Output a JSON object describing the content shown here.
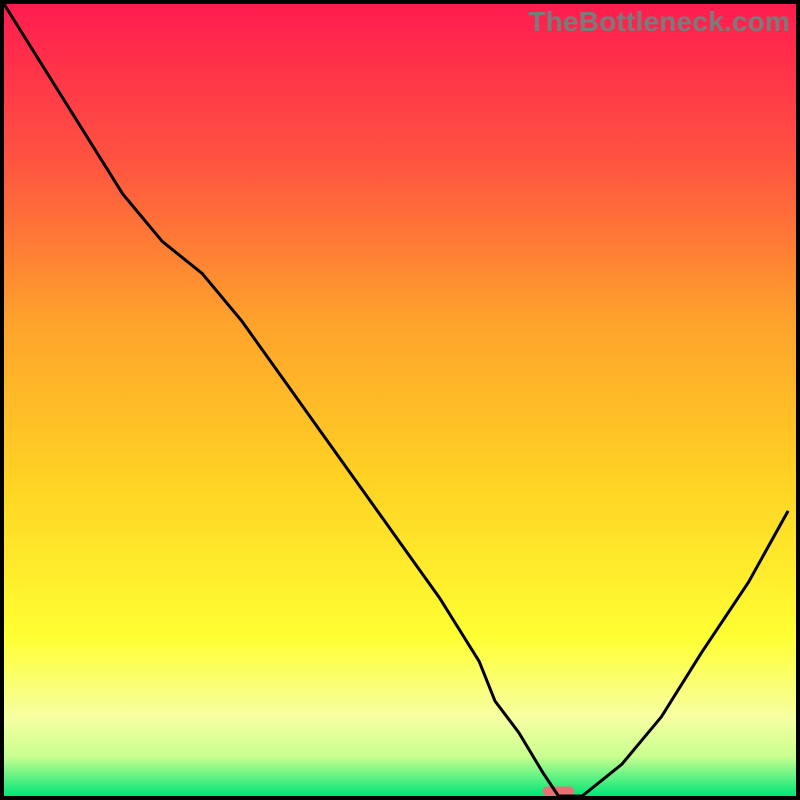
{
  "watermark": "TheBottleneck.com",
  "chart_data": {
    "type": "line",
    "title": "",
    "xlabel": "",
    "ylabel": "",
    "xlim": [
      0,
      100
    ],
    "ylim": [
      0,
      100
    ],
    "grid": false,
    "series": [
      {
        "name": "bottleneck-curve",
        "color": "#000000",
        "x": [
          0,
          5,
          10,
          15,
          20,
          25,
          30,
          35,
          40,
          45,
          50,
          55,
          60,
          62,
          65,
          68,
          70,
          73,
          78,
          83,
          88,
          94,
          99
        ],
        "y": [
          100,
          92,
          84,
          76,
          70,
          66,
          60,
          53,
          46,
          39,
          32,
          25,
          17,
          12,
          8,
          3,
          0,
          0,
          4,
          10,
          18,
          27,
          36
        ]
      }
    ],
    "background_gradient": {
      "type": "vertical",
      "stops": [
        {
          "pct": 0,
          "color": "#ff1c4f"
        },
        {
          "pct": 20,
          "color": "#ff5440"
        },
        {
          "pct": 40,
          "color": "#ffa22c"
        },
        {
          "pct": 60,
          "color": "#ffd223"
        },
        {
          "pct": 80,
          "color": "#ffff33"
        },
        {
          "pct": 90,
          "color": "#f7ffa2"
        },
        {
          "pct": 95,
          "color": "#c9ff90"
        },
        {
          "pct": 100,
          "color": "#00e676"
        }
      ]
    },
    "marker": {
      "x": 70,
      "y": 0,
      "color": "#e57373",
      "width_pct": 4,
      "height_pct": 1.2
    }
  }
}
